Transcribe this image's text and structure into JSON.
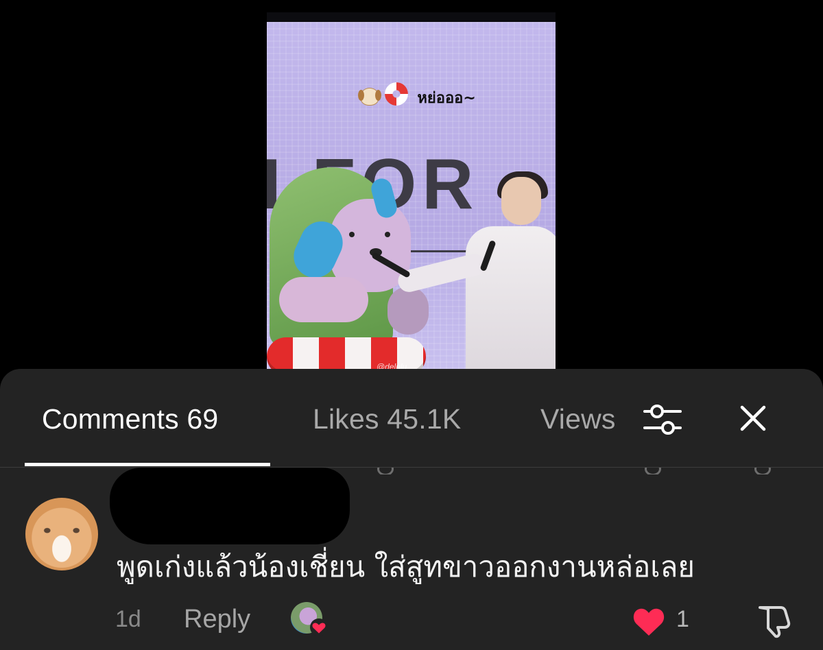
{
  "video": {
    "caption_text": "หย่อออ~",
    "caption_emojis": [
      "dog-face",
      "ring-buoy"
    ],
    "backdrop_text": "I FOR",
    "watermark": "@delulu"
  },
  "sheet": {
    "tabs": [
      {
        "label": "Comments 69",
        "active": true
      },
      {
        "label": "Likes 45.1K",
        "active": false
      },
      {
        "label": "Views",
        "active": false
      }
    ],
    "icons": [
      "filter-sliders-icon",
      "close-icon"
    ]
  },
  "comment": {
    "author": "",
    "text": "พูดเก่งแล้วน้องเชี่ยน ใส่สูทขาวออกงานหล่อเลย",
    "time": "1d",
    "reply_label": "Reply",
    "like_count": "1",
    "liked": true,
    "creator_liked": true
  },
  "colors": {
    "sheet_bg": "#232323",
    "active_tab": "#ffffff",
    "inactive_tab": "#a9a9a9",
    "like_red": "#fe2c55"
  }
}
